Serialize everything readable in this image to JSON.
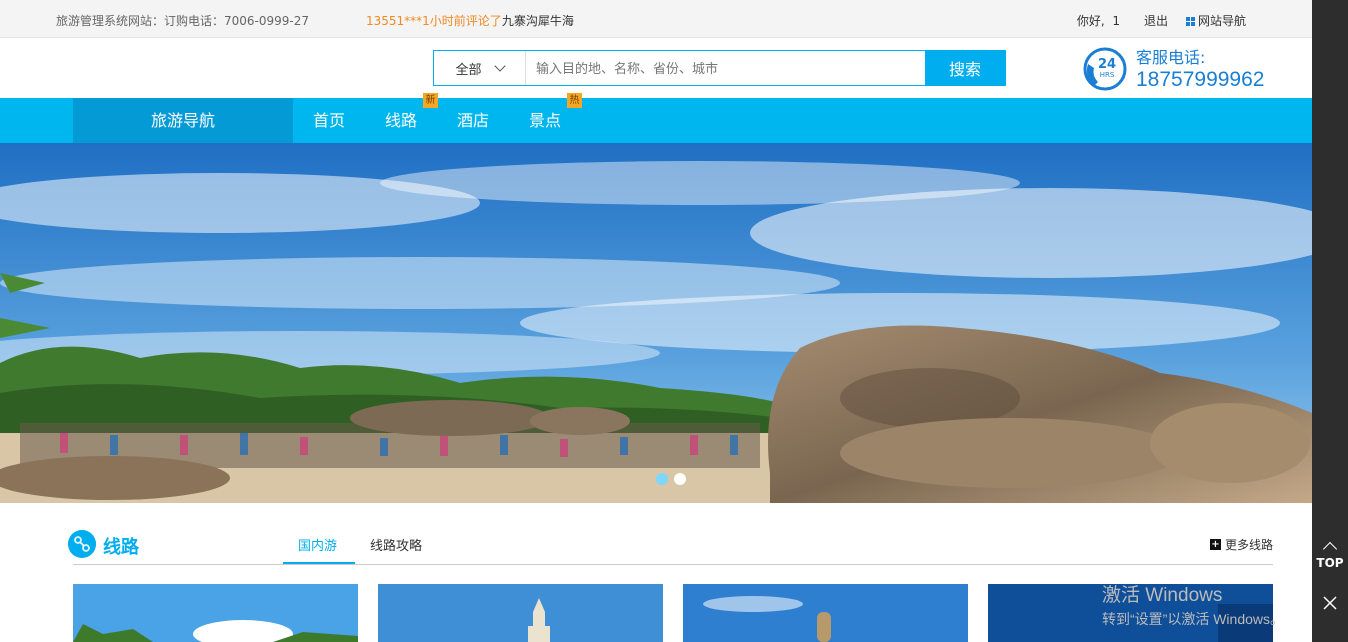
{
  "topbar": {
    "site_info": "旅游管理系统网站：订购电话：7006-0999-27",
    "news_who": "13551***1小时前评论了",
    "news_place": "九寨沟犀牛海",
    "greeting": "你好,",
    "user_id": "1",
    "logout": "退出",
    "site_nav": "网站导航"
  },
  "search": {
    "category": "全部",
    "placeholder": "输入目的地、名称、省份、城市",
    "button": "搜索"
  },
  "hotline": {
    "badge": "24",
    "badge_sub": "HRS",
    "label": "客服电话:",
    "number": "18757999962"
  },
  "nav": {
    "home": "旅游导航",
    "items": [
      {
        "label": "首页",
        "badge": ""
      },
      {
        "label": "线路",
        "badge": "新"
      },
      {
        "label": "酒店",
        "badge": ""
      },
      {
        "label": "景点",
        "badge": "热"
      }
    ]
  },
  "banner": {
    "slide_count": 2,
    "active_slide": 1
  },
  "section": {
    "title": "线路",
    "tabs": [
      "国内游",
      "线路攻略"
    ],
    "active_tab": 0,
    "more": "更多线路"
  },
  "watermark": {
    "title": "激活 Windows",
    "subtitle": "转到“设置”以激活 Windows。"
  },
  "rail": {
    "top_label": "TOP"
  },
  "colors": {
    "accent": "#00b6ee",
    "nav_home": "#049ad6",
    "highlight": "#f08a24",
    "hotline": "#1a7fd4"
  }
}
